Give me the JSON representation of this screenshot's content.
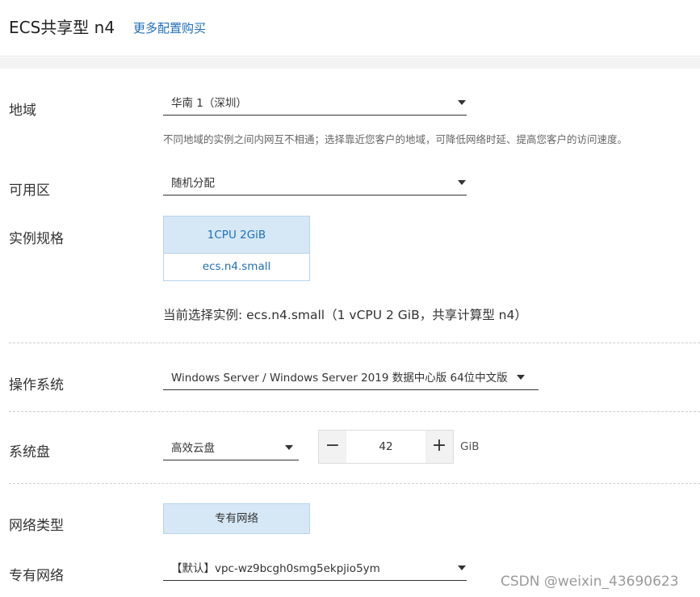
{
  "header": {
    "title": "ECS共享型 n4",
    "more_link": "更多配置购买"
  },
  "region": {
    "label": "地域",
    "value": "华南 1（深圳）",
    "hint": "不同地域的实例之间内网互不相通；选择靠近您客户的地域，可降低网络时延、提高您客户的访问速度。"
  },
  "zone": {
    "label": "可用区",
    "value": "随机分配"
  },
  "spec": {
    "label": "实例规格",
    "cpu_mem": "1CPU 2GiB",
    "name": "ecs.n4.small",
    "current": "当前选择实例: ecs.n4.small（1 vCPU 2 GiB，共享计算型 n4）"
  },
  "os": {
    "label": "操作系统",
    "value": "Windows Server / Windows Server 2019 数据中心版 64位中文版"
  },
  "disk": {
    "label": "系统盘",
    "type_value": "高效云盘",
    "minus": "−",
    "plus": "+",
    "size": "42",
    "unit": "GiB"
  },
  "network_type": {
    "label": "网络类型",
    "option": "专有网络"
  },
  "vpc": {
    "label": "专有网络",
    "value": "【默认】vpc-wz9bcgh0smg5ekpjio5ym"
  },
  "watermark": "CSDN @weixin_43690623",
  "colors": {
    "accent": "#1f6fb8",
    "selected_bg": "#d6e8f6",
    "selected_border": "#b7d3ea"
  }
}
